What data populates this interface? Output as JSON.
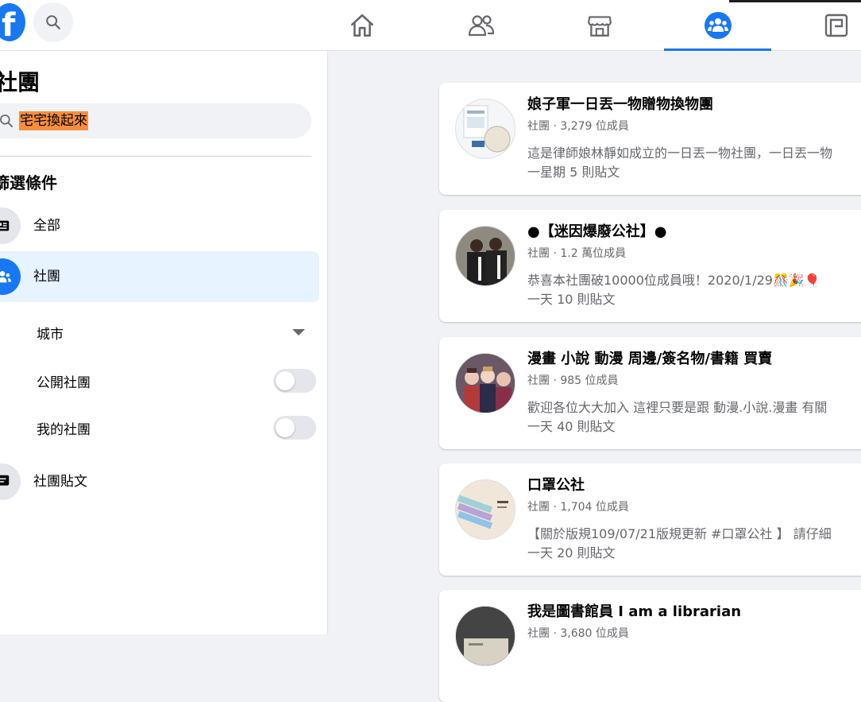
{
  "topbar": {
    "logo_letter": "f",
    "icons": [
      "facebook-logo-icon",
      "search-icon",
      "home-icon",
      "friends-icon",
      "marketplace-icon",
      "groups-icon",
      "gaming-icon"
    ],
    "active_tab": "groups",
    "accent_color": "#1877f2"
  },
  "sidebar": {
    "title": "社團",
    "search_value": "宅宅換起來",
    "search_highlight_color": "#f68e3e",
    "filter_heading": "篩選條件",
    "items": [
      {
        "label": "全部",
        "icon": "results-icon"
      },
      {
        "label": "社團",
        "icon": "groups-icon"
      },
      {
        "label": "社團貼文",
        "icon": "chat-icon"
      }
    ],
    "sub_filters": [
      {
        "label": "城市",
        "control": "dropdown"
      },
      {
        "label": "公開社團",
        "control": "toggle",
        "on": false
      },
      {
        "label": "我的社團",
        "control": "toggle",
        "on": false
      }
    ]
  },
  "results": [
    {
      "name": "娘子軍一日丟一物贈物換物團",
      "meta": "社團 · 3,279 位成員",
      "desc": "這是律師娘林靜如成立的一日丟一物社團，一日丟一物",
      "activity": "一星期 5 則貼文"
    },
    {
      "name": "●【迷因爆廢公社】●",
      "meta": "社團 · 1.2 萬位成員",
      "desc": "恭喜本社團破10000位成員哦！2020/1/29🎊🎉🎈",
      "activity": "一天 10 則貼文"
    },
    {
      "name": "漫畫 小說 動漫 周邊/簽名物/書籍 買賣",
      "meta": "社團 · 985 位成員",
      "desc": "歡迎各位大大加入 這裡只要是跟 動漫.小說.漫畫 有關",
      "activity": "一天 40 則貼文"
    },
    {
      "name": "口罩公社",
      "meta": "社團 · 1,704 位成員",
      "desc": "【關於版規109/07/21版規更新 #口罩公社 】 請仔細",
      "activity": "一天 20 則貼文"
    },
    {
      "name": "我是圖書館員 I am a librarian",
      "meta": "社團 · 3,680 位成員",
      "desc": "",
      "activity": ""
    }
  ]
}
